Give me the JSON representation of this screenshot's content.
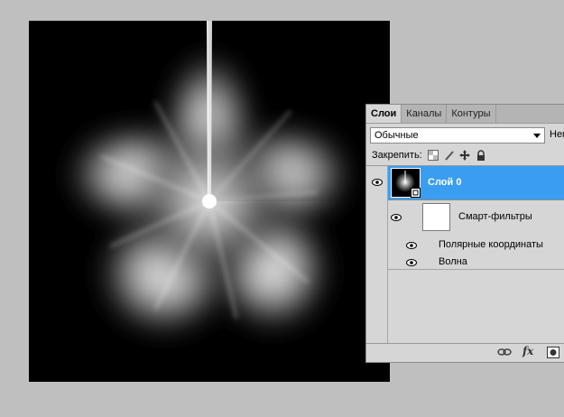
{
  "canvas": {
    "background": "#000000",
    "artwork": "radial-light-burst"
  },
  "panel": {
    "tabs": [
      {
        "label": "Слои",
        "active": true
      },
      {
        "label": "Каналы",
        "active": false
      },
      {
        "label": "Контуры",
        "active": false
      }
    ],
    "blend_mode": "Обычные",
    "opacity_label": "Неп",
    "lock_label": "Закрепить:",
    "lock_icons": [
      "lock-transparent-icon",
      "lock-brush-icon",
      "lock-move-icon",
      "lock-all-icon"
    ],
    "layer": {
      "name": "Слой 0",
      "selected": true,
      "highlight_color": "#3b9df0"
    },
    "smart_filters": {
      "label": "Смарт-фильтры",
      "filters": [
        "Полярные координаты",
        "Волна"
      ]
    },
    "bottom_icons": [
      "link-layers-icon",
      "fx-icon",
      "add-mask-icon"
    ],
    "fx_label": "fx"
  }
}
